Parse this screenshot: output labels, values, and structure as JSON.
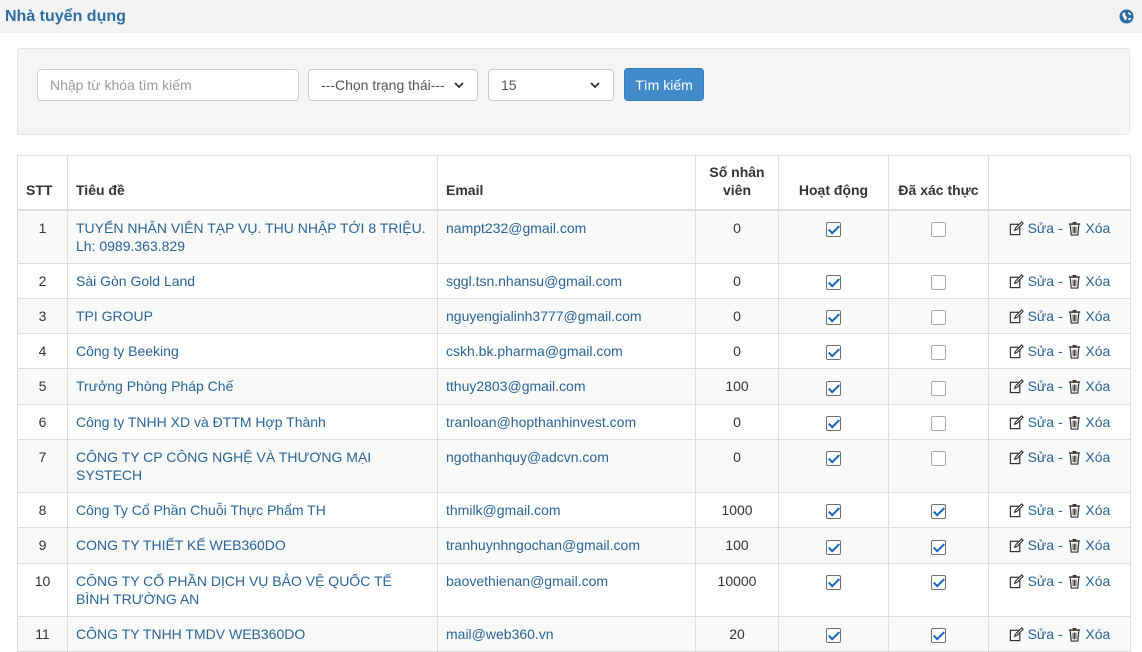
{
  "header": {
    "title": "Nhà tuyển dụng",
    "icon": "globe-icon"
  },
  "filters": {
    "search_placeholder": "Nhập từ khóa tìm kiếm",
    "status_selected": "---Chọn trạng thái---",
    "page_size_selected": "15",
    "search_button": "Tìm kiếm"
  },
  "table": {
    "headers": {
      "stt": "STT",
      "title": "Tiêu đề",
      "email": "Email",
      "employees_line1": "Số nhân",
      "employees_line2": "viên",
      "active": "Hoạt động",
      "verified": "Đã xác thực"
    },
    "edit_label": "Sửa",
    "separator": "-",
    "delete_label": "Xóa",
    "rows": [
      {
        "stt": "1",
        "title": "TUYỂN NHÂN VIÊN TẠP VỤ. THU NHẬP TỚI 8 TRIỆU. Lh: 0989.363.829",
        "email": "nampt232@gmail.com",
        "employees": "0",
        "active": true,
        "verified": false
      },
      {
        "stt": "2",
        "title": "Sài Gòn Gold Land",
        "email": "sggl.tsn.nhansu@gmail.com",
        "employees": "0",
        "active": true,
        "verified": false
      },
      {
        "stt": "3",
        "title": "TPI GROUP",
        "email": "nguyengialinh3777@gmail.com",
        "employees": "0",
        "active": true,
        "verified": false
      },
      {
        "stt": "4",
        "title": "Công ty Beeking",
        "email": "cskh.bk.pharma@gmail.com",
        "employees": "0",
        "active": true,
        "verified": false
      },
      {
        "stt": "5",
        "title": "Trưởng Phòng Pháp Chế",
        "email": "tthuy2803@gmail.com",
        "employees": "100",
        "active": true,
        "verified": false
      },
      {
        "stt": "6",
        "title": "Công ty TNHH XD và ĐTTM Hợp Thành",
        "email": "tranloan@hopthanhinvest.com",
        "employees": "0",
        "active": true,
        "verified": false
      },
      {
        "stt": "7",
        "title": "CÔNG TY CP CÔNG NGHỆ VÀ THƯƠNG MẠI SYSTECH",
        "email": "ngothanhquy@adcvn.com",
        "employees": "0",
        "active": true,
        "verified": false
      },
      {
        "stt": "8",
        "title": "Công Ty Cổ Phần Chuỗi Thực Phẩm TH",
        "email": "thmilk@gmail.com",
        "employees": "1000",
        "active": true,
        "verified": true
      },
      {
        "stt": "9",
        "title": "CONG TY THIẾT KẾ WEB360DO",
        "email": "tranhuynhngochan@gmail.com",
        "employees": "100",
        "active": true,
        "verified": true
      },
      {
        "stt": "10",
        "title": "CÔNG TY CỔ PHẦN DỊCH VỤ BẢO VỆ QUỐC TẾ BÌNH TRƯỜNG AN",
        "email": "baovethienan@gmail.com",
        "employees": "10000",
        "active": true,
        "verified": true
      },
      {
        "stt": "11",
        "title": "CÔNG TY TNHH TMDV WEB360DO",
        "email": "mail@web360.vn",
        "employees": "20",
        "active": true,
        "verified": true
      }
    ]
  }
}
